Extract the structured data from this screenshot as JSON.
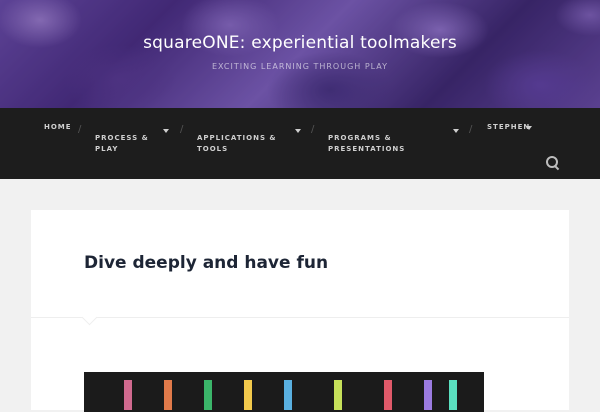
{
  "header": {
    "title": "squareONE: experiential toolmakers",
    "tagline": "EXCITING LEARNING THROUGH PLAY"
  },
  "nav": {
    "items": [
      {
        "label": "HOME",
        "dropdown": false
      },
      {
        "label": "PROCESS &\nPLAY",
        "dropdown": true
      },
      {
        "label": "APPLICATIONS &\nTOOLS",
        "dropdown": true
      },
      {
        "label": "PROGRAMS &\nPRESENTATIONS",
        "dropdown": true
      },
      {
        "label": "STEPHEN",
        "dropdown": true
      }
    ],
    "separator": "/",
    "search_icon": "search-icon"
  },
  "post": {
    "title": "Dive deeply and have fun"
  },
  "colors": {
    "nav_bg": "#1d1d1d",
    "page_bg": "#f1f1f1",
    "title_color": "#1d2535"
  }
}
